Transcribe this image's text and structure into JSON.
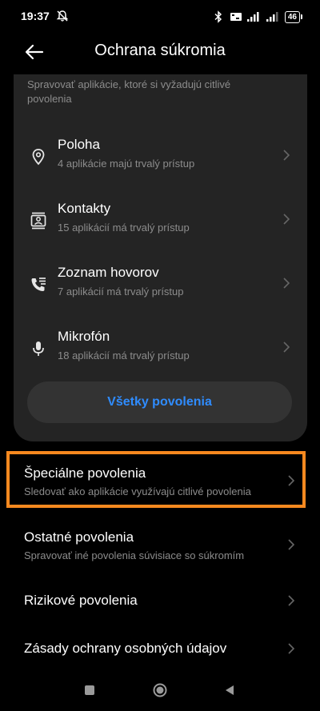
{
  "status_bar": {
    "time": "19:37",
    "battery": "46"
  },
  "header": {
    "title": "Ochrana súkromia"
  },
  "card": {
    "description": "Spravovať aplikácie, ktoré si vyžadujú citlivé povolenia",
    "permissions": [
      {
        "title": "Poloha",
        "subtitle": "4 aplikácie majú trvalý prístup",
        "icon": "location-pin-icon"
      },
      {
        "title": "Kontakty",
        "subtitle": "15 aplikácií má trvalý prístup",
        "icon": "contacts-icon"
      },
      {
        "title": "Zoznam hovorov",
        "subtitle": "7 aplikácií má trvalý prístup",
        "icon": "call-log-icon"
      },
      {
        "title": "Mikrofón",
        "subtitle": "18 aplikácií má trvalý prístup",
        "icon": "microphone-icon"
      }
    ],
    "all_button": "Všetky povolenia"
  },
  "rows": [
    {
      "title": "Špeciálne povolenia",
      "subtitle": "Sledovať ako aplikácie využívajú citlivé povolenia"
    },
    {
      "title": "Ostatné povolenia",
      "subtitle": "Spravovať iné povolenia súvisiace so súkromím"
    },
    {
      "title": "Rizikové povolenia"
    },
    {
      "title": "Zásady ochrany osobných údajov"
    }
  ],
  "colors": {
    "accent": "#2f8cff",
    "highlight": "#f7891f",
    "card_bg": "#242424"
  }
}
